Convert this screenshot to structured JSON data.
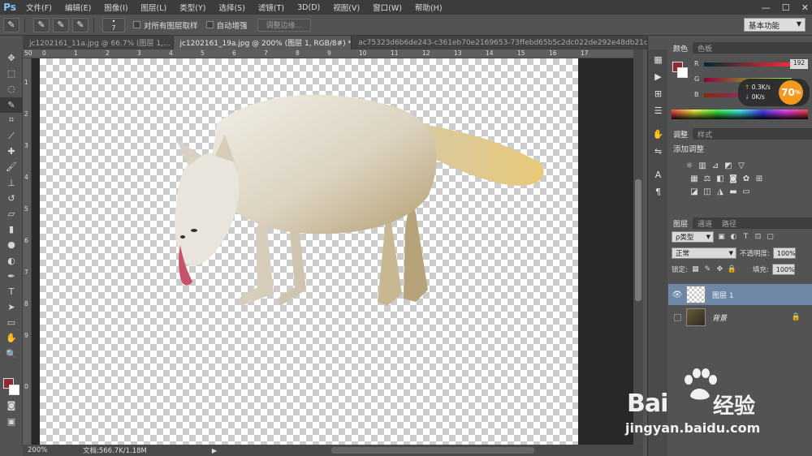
{
  "app": {
    "logo": "Ps"
  },
  "menu": [
    "文件(F)",
    "编辑(E)",
    "图像(I)",
    "图层(L)",
    "类型(Y)",
    "选择(S)",
    "滤镜(T)",
    "3D(D)",
    "视图(V)",
    "窗口(W)",
    "帮助(H)"
  ],
  "window_controls": {
    "minimize": "—",
    "maximize": "☐",
    "close": "✕"
  },
  "options": {
    "brush_size": "7",
    "sample_all_layers": "对所有图层取样",
    "auto_enhance": "自动增强",
    "refine_edge": "调整边缘...",
    "workspace": "基本功能"
  },
  "tabs": [
    {
      "label": "jc1202161_11a.jpg @ 66.7% (图层 1,...",
      "close": "×",
      "active": false
    },
    {
      "label": "jc1202161_19a.jpg @ 200% (图层 1, RGB/8#) *",
      "close": "×",
      "active": true
    },
    {
      "label": "ac75323d6b6de243-c361eb70e2169653-73ffebd65b5c2dc022de292e48db21c7_i.jpg",
      "close": "",
      "active": false
    }
  ],
  "ruler_top": [
    "50",
    "0",
    "1",
    "2",
    "3",
    "4",
    "5",
    "6",
    "7",
    "8",
    "9",
    "10",
    "11",
    "12",
    "13",
    "14",
    "15",
    "16",
    "17"
  ],
  "ruler_left": [
    "1",
    "2",
    "3",
    "4",
    "5",
    "6",
    "7",
    "8",
    "9",
    "0"
  ],
  "status": {
    "zoom": "200%",
    "doc": "文档:566.7K/1.18M",
    "arrow": "▶"
  },
  "color_panel": {
    "tabs": [
      "颜色",
      "色板"
    ],
    "channels": [
      {
        "label": "R",
        "value": "192"
      },
      {
        "label": "G",
        "value": ""
      },
      {
        "label": "B",
        "value": "61"
      }
    ],
    "net_up": "0.3K/s",
    "net_down": "0K/s",
    "net_percent": "70",
    "net_percent_sign": "%",
    "colors": {
      "foreground": "#8d2a34",
      "background": "#ffffff"
    }
  },
  "adjust_panel": {
    "tabs": [
      "调整",
      "样式"
    ],
    "title": "添加调整"
  },
  "layers_panel": {
    "tabs": [
      "图层",
      "通道",
      "路径"
    ],
    "filter": "ρ类型",
    "blend_mode": "正常",
    "opacity_label": "不透明度:",
    "opacity": "100%",
    "lock_label": "锁定:",
    "fill_label": "填充:",
    "fill": "100%",
    "layers": [
      {
        "name": "图层 1",
        "selected": true,
        "visible": true
      },
      {
        "name": "背景",
        "selected": false,
        "visible": false,
        "locked": true
      }
    ]
  },
  "watermark": {
    "brand": "Bai",
    "brand2": "经验",
    "url": "jingyan.baidu.com"
  }
}
